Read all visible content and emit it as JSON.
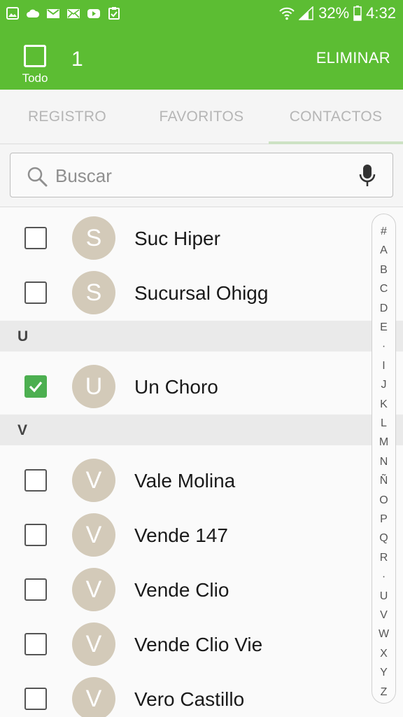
{
  "status_bar": {
    "battery": "32%",
    "time": "4:32",
    "left_icons": [
      "image-icon",
      "cloud-icon",
      "gmail-icon",
      "mail-icon",
      "youtube-icon",
      "clipboard-check-icon"
    ]
  },
  "action_bar": {
    "select_all_label": "Todo",
    "selected_count": "1",
    "delete_label": "ELIMINAR",
    "color": "#5cbd33"
  },
  "tabs": [
    {
      "label": "REGISTRO",
      "active": false
    },
    {
      "label": "FAVORITOS",
      "active": false
    },
    {
      "label": "CONTACTOS",
      "active": true
    }
  ],
  "search": {
    "placeholder": "Buscar"
  },
  "contacts": {
    "rows": [
      {
        "kind": "contact",
        "initial": "S",
        "name": "Suc Hiper",
        "checked": false
      },
      {
        "kind": "contact",
        "initial": "S",
        "name": "Sucursal Ohigg",
        "checked": false
      },
      {
        "kind": "section",
        "letter": "U"
      },
      {
        "kind": "contact",
        "initial": "U",
        "name": "Un Choro",
        "checked": true
      },
      {
        "kind": "section",
        "letter": "V"
      },
      {
        "kind": "contact",
        "initial": "V",
        "name": "Vale Molina",
        "checked": false
      },
      {
        "kind": "contact",
        "initial": "V",
        "name": "Vende 147",
        "checked": false
      },
      {
        "kind": "contact",
        "initial": "V",
        "name": "Vende Clio",
        "checked": false
      },
      {
        "kind": "contact",
        "initial": "V",
        "name": "Vende Clio Vie",
        "checked": false
      },
      {
        "kind": "contact",
        "initial": "V",
        "name": "Vero Castillo",
        "checked": false
      }
    ]
  },
  "index_letters": [
    "#",
    "A",
    "B",
    "C",
    "D",
    "E",
    "·",
    "I",
    "J",
    "K",
    "L",
    "M",
    "N",
    "Ñ",
    "O",
    "P",
    "Q",
    "R",
    "·",
    "U",
    "V",
    "W",
    "X",
    "Y",
    "Z"
  ]
}
